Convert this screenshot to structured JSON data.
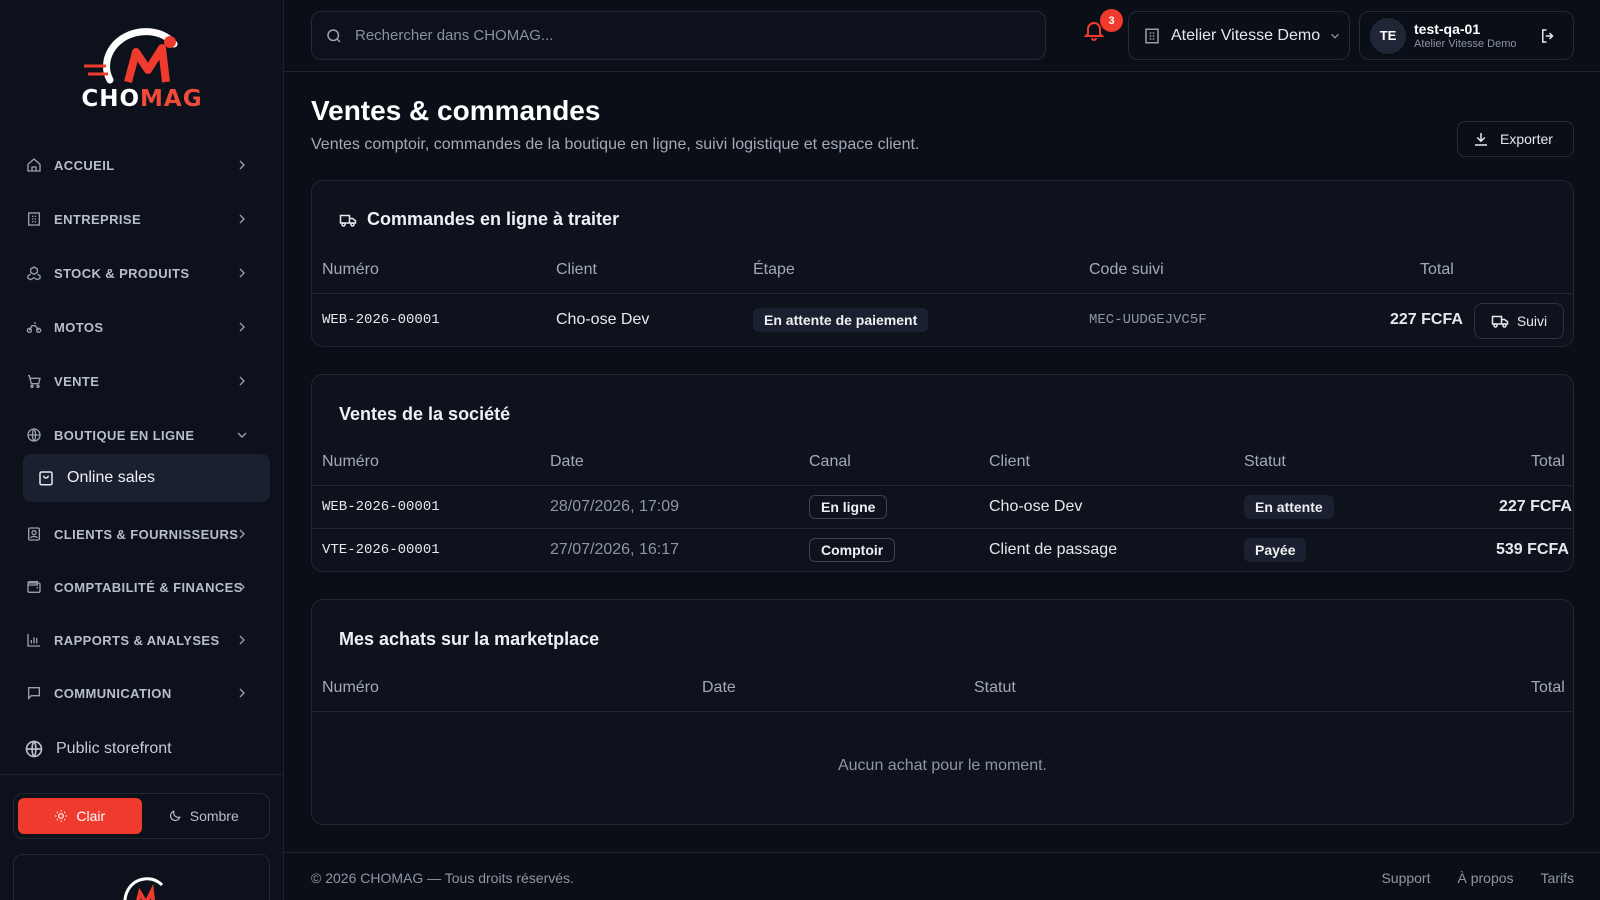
{
  "brand": {
    "logo_text_a": "CHO",
    "logo_text_b": "MAG",
    "accent": "#ef3b2d"
  },
  "sidebar": {
    "items": [
      {
        "label": "ACCUEIL",
        "icon": "home-icon"
      },
      {
        "label": "ENTREPRISE",
        "icon": "building-icon"
      },
      {
        "label": "STOCK & PRODUITS",
        "icon": "boxes-icon"
      },
      {
        "label": "MOTOS",
        "icon": "bike-icon"
      },
      {
        "label": "VENTE",
        "icon": "cart-icon"
      },
      {
        "label": "BOUTIQUE EN LIGNE",
        "icon": "globe-icon",
        "expanded": true
      },
      {
        "label": "CLIENTS & FOURNISSEURS",
        "icon": "contacts-icon"
      },
      {
        "label": "COMPTABILITÉ & FINANCES",
        "icon": "wallet-icon"
      },
      {
        "label": "RAPPORTS & ANALYSES",
        "icon": "chart-icon"
      },
      {
        "label": "COMMUNICATION",
        "icon": "message-icon"
      }
    ],
    "sub_item": {
      "label": "Online sales",
      "icon": "shopping-bag-icon"
    },
    "public_storefront": {
      "label": "Public storefront",
      "icon": "globe-icon"
    },
    "theme": {
      "light_label": "Clair",
      "dark_label": "Sombre",
      "active": "light"
    }
  },
  "header": {
    "search_placeholder": "Rechercher dans CHOMAG...",
    "notification_count": "3",
    "company": "Atelier Vitesse Demo",
    "user": {
      "initials": "TE",
      "name": "test-qa-01",
      "company": "Atelier Vitesse Demo"
    }
  },
  "page": {
    "title": "Ventes & commandes",
    "subtitle": "Ventes comptoir, commandes de la boutique en ligne, suivi logistique et espace client.",
    "export_label": "Exporter"
  },
  "online_orders": {
    "title": "Commandes en ligne à traiter",
    "columns": [
      "Numéro",
      "Client",
      "Étape",
      "Code suivi",
      "Total"
    ],
    "rows": [
      {
        "numero": "WEB-2026-00001",
        "client": "Cho-ose Dev",
        "etape": "En attente de paiement",
        "code": "MEC-UUDGEJVC5F",
        "total": "227 FCFA",
        "action": "Suivi"
      }
    ]
  },
  "company_sales": {
    "title": "Ventes de la société",
    "columns": [
      "Numéro",
      "Date",
      "Canal",
      "Client",
      "Statut",
      "Total"
    ],
    "rows": [
      {
        "numero": "WEB-2026-00001",
        "date": "28/07/2026, 17:09",
        "canal": "En ligne",
        "client": "Cho-ose Dev",
        "statut": "En attente",
        "total": "227 FCFA"
      },
      {
        "numero": "VTE-2026-00001",
        "date": "27/07/2026, 16:17",
        "canal": "Comptoir",
        "client": "Client de passage",
        "statut": "Payée",
        "total": "539 FCFA"
      }
    ]
  },
  "marketplace": {
    "title": "Mes achats sur la marketplace",
    "columns": [
      "Numéro",
      "Date",
      "Statut",
      "Total"
    ],
    "empty": "Aucun achat pour le moment."
  },
  "footer": {
    "copyright": "© 2026 CHOMAG — Tous droits réservés.",
    "links": [
      "Support",
      "À propos",
      "Tarifs"
    ]
  }
}
